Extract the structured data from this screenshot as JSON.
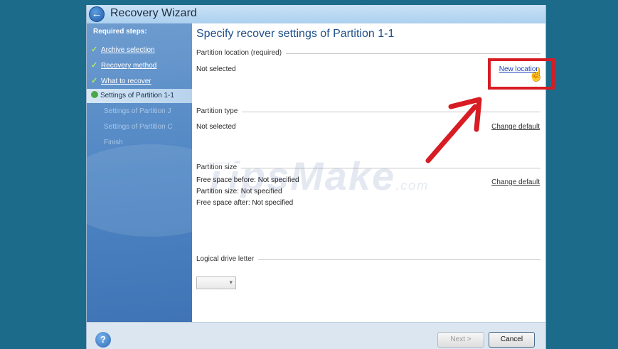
{
  "window": {
    "title": "Recovery Wizard"
  },
  "sidebar": {
    "heading": "Required steps:",
    "completed": [
      "Archive selection",
      "Recovery method",
      "What to recover"
    ],
    "current": "Settings of Partition 1-1",
    "pending": [
      "Settings of Partition J",
      "Settings of Partition C",
      "Finish"
    ]
  },
  "main": {
    "heading": "Specify recover settings of Partition 1-1",
    "location": {
      "label": "Partition location (required)",
      "value": "Not selected",
      "link": "New location"
    },
    "type": {
      "label": "Partition type",
      "value": "Not selected",
      "link": "Change default"
    },
    "size": {
      "label": "Partition size",
      "free_before": "Free space before: Not specified",
      "partition_size": "Partition size: Not specified",
      "free_after": "Free space after: Not specified",
      "link": "Change default"
    },
    "drive_letter": {
      "label": "Logical drive letter",
      "value": ""
    }
  },
  "watermark": {
    "main": "TipsMake",
    "suffix": ".com"
  },
  "footer": {
    "next": "Next >",
    "cancel": "Cancel"
  },
  "colors": {
    "highlight": "#d71c24",
    "link": "#1a3fb8"
  }
}
